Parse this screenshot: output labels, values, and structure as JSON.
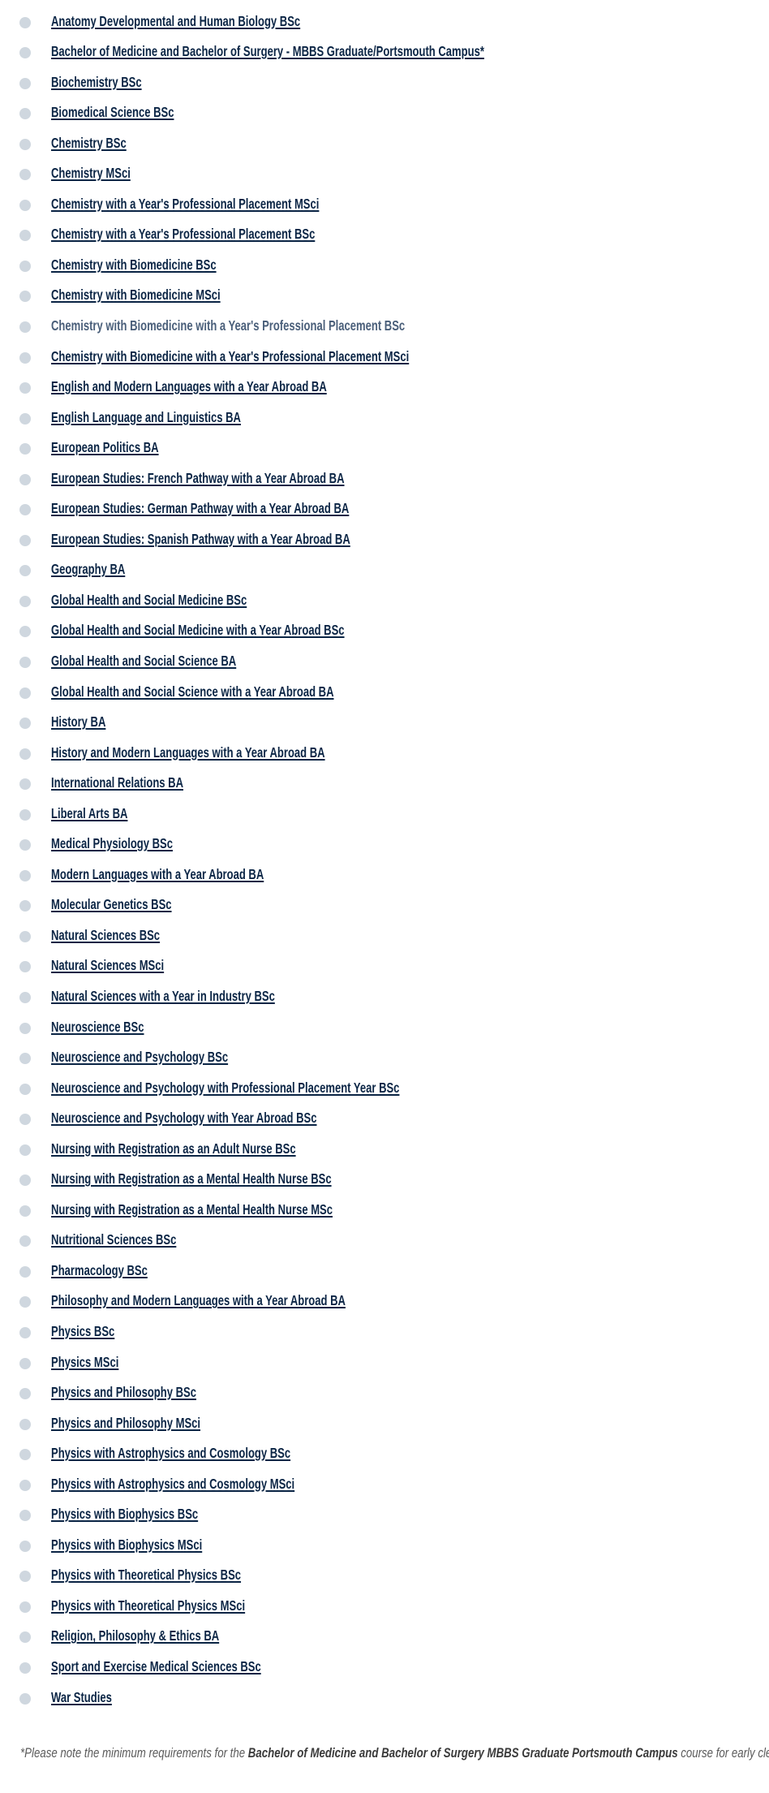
{
  "courses": [
    {
      "label": "Anatomy Developmental and Human Biology BSc"
    },
    {
      "label": "Bachelor of Medicine and Bachelor of Surgery - MBBS Graduate/Portsmouth Campus*"
    },
    {
      "label": "Biochemistry BSc"
    },
    {
      "label": "Biomedical Science BSc"
    },
    {
      "label": "Chemistry BSc"
    },
    {
      "label": "Chemistry MSci"
    },
    {
      "label": "Chemistry with a Year's Professional Placement MSci"
    },
    {
      "label": "Chemistry with a Year's Professional Placement BSc"
    },
    {
      "label": "Chemistry with Biomedicine BSc"
    },
    {
      "label": "Chemistry with Biomedicine MSci"
    },
    {
      "label": "Chemistry with Biomedicine with a Year's Professional Placement BSc",
      "state": "visited"
    },
    {
      "label": "Chemistry with Biomedicine with a Year's Professional Placement MSci"
    },
    {
      "label": "English and Modern Languages with a Year Abroad BA"
    },
    {
      "label": "English Language and Linguistics BA"
    },
    {
      "label": "European Politics BA"
    },
    {
      "label": "European Studies: French Pathway with a Year Abroad BA"
    },
    {
      "label": "European Studies: German Pathway with a Year Abroad BA"
    },
    {
      "label": "European Studies: Spanish Pathway with a Year Abroad BA"
    },
    {
      "label": "Geography BA"
    },
    {
      "label": "Global Health and Social Medicine BSc"
    },
    {
      "label": "Global Health and Social Medicine with a Year Abroad BSc"
    },
    {
      "label": "Global Health and Social Science BA"
    },
    {
      "label": "Global Health and Social Science with a Year Abroad BA"
    },
    {
      "label": "History BA"
    },
    {
      "label": "History and Modern Languages with a Year Abroad BA"
    },
    {
      "label": "International Relations BA"
    },
    {
      "label": "Liberal Arts BA"
    },
    {
      "label": "Medical Physiology BSc"
    },
    {
      "label": "Modern Languages with a Year Abroad BA"
    },
    {
      "label": "Molecular Genetics BSc"
    },
    {
      "label": "Natural Sciences BSc"
    },
    {
      "label": "Natural Sciences MSci"
    },
    {
      "label": "Natural Sciences with a Year in Industry BSc"
    },
    {
      "label": "Neuroscience BSc"
    },
    {
      "label": "Neuroscience and Psychology BSc"
    },
    {
      "label": "Neuroscience and Psychology with Professional Placement Year BSc"
    },
    {
      "label": "Neuroscience and Psychology with Year Abroad BSc"
    },
    {
      "label": "Nursing with Registration as an Adult Nurse BSc"
    },
    {
      "label": "Nursing with Registration as a Mental Health Nurse BSc"
    },
    {
      "label": "Nursing with Registration as a Mental Health Nurse MSc"
    },
    {
      "label": "Nutritional Sciences BSc"
    },
    {
      "label": "Pharmacology BSc"
    },
    {
      "label": "Philosophy and Modern Languages with a Year Abroad BA"
    },
    {
      "label": "Physics BSc"
    },
    {
      "label": "Physics MSci"
    },
    {
      "label": "Physics and Philosophy BSc"
    },
    {
      "label": "Physics and Philosophy MSci"
    },
    {
      "label": "Physics with Astrophysics and Cosmology BSc"
    },
    {
      "label": "Physics with Astrophysics and Cosmology MSci"
    },
    {
      "label": "Physics with Biophysics BSc"
    },
    {
      "label": "Physics with Biophysics MSci"
    },
    {
      "label": "Physics with Theoretical Physics BSc"
    },
    {
      "label": "Physics with Theoretical Physics MSci"
    },
    {
      "label": "Religion, Philosophy & Ethics BA "
    },
    {
      "label": "Sport and Exercise Medical Sciences BSc"
    },
    {
      "label": "War Studies"
    }
  ],
  "note": {
    "prefix": "*Please note the minimum requirements for the ",
    "course": "Bachelor of Medicine and Bachelor of Surgery MBBS Graduate Portsmouth Campus",
    "suffix": " course for early clearing are as follows:"
  },
  "colors": {
    "link": "#0b2545",
    "link_visited": "#4a5f7a",
    "bullet": "#cfd7df",
    "note_text": "#5a5a5a"
  }
}
